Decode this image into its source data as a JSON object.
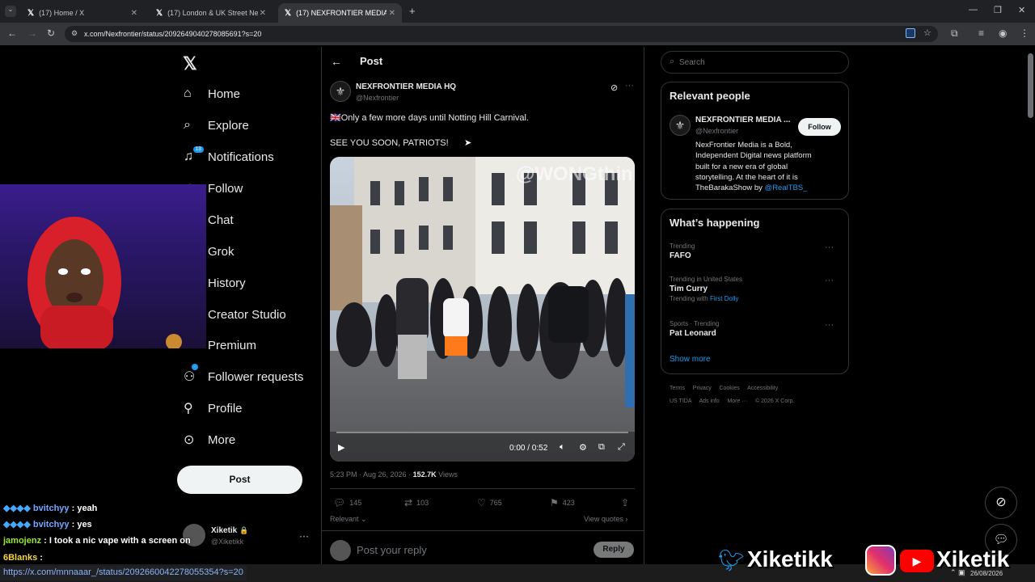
{
  "browser": {
    "tabs": [
      {
        "label": "(17) Home / X"
      },
      {
        "label": "(17) London & UK Street News"
      },
      {
        "label": "(17) NEXFRONTIER MEDIA HQ"
      }
    ],
    "url": "x.com/Nexfrontier/status/2092649040278085691?s=20"
  },
  "nav": {
    "items": [
      {
        "label": "Home"
      },
      {
        "label": "Explore"
      },
      {
        "label": "Notifications",
        "badge": "13"
      },
      {
        "label": "Follow"
      },
      {
        "label": "Chat"
      },
      {
        "label": "Grok"
      },
      {
        "label": "History"
      },
      {
        "label": "Creator Studio"
      },
      {
        "label": "Premium"
      },
      {
        "label": "Follower requests"
      },
      {
        "label": "Profile"
      },
      {
        "label": "More"
      }
    ],
    "post_button": "Post",
    "account": {
      "name": "Xiketik",
      "handle": "@Xiketikk"
    }
  },
  "post": {
    "header": "Post",
    "author": "NEXFRONTIER MEDIA HQ",
    "handle": "@Nexfrontier",
    "text1": "🇬🇧Only a few more days until Notting Hill Carnival.",
    "text2": "SEE YOU SOON, PATRIOTS!",
    "video_watermark": "@WONGthink",
    "video_time": "0:00 / 0:52",
    "video_progress": 0.0,
    "timestamp": "5:23 PM · Aug 26, 2026 · ",
    "views_count": "152.7K",
    "views_label": " Views",
    "replies": "145",
    "reposts": "103",
    "likes": "765",
    "bookmarks": "423",
    "sort_label": "Relevant",
    "view_quotes": "View quotes",
    "reply_placeholder": "Post your reply",
    "reply_button": "Reply"
  },
  "sidebar": {
    "search_placeholder": "Search",
    "relevant_title": "Relevant people",
    "person": {
      "name": "NEXFRONTIER MEDIA ...",
      "handle": "@Nexfrontier",
      "follow": "Follow",
      "bio_line1": "NexFrontier Media is a Bold,",
      "bio_line2": "Independent Digital news platform",
      "bio_line3": "built for a new era of global",
      "bio_line4": "storytelling. At the heart of it is",
      "bio_line5": "TheBarakaShow by ",
      "bio_link": "@RealTBS_"
    },
    "happening_title": "What’s happening",
    "trends": [
      {
        "context": "Trending",
        "name": "FAFO"
      },
      {
        "context": "Trending in United States",
        "name": "Tim Curry",
        "extra": "Trending with ",
        "extra_link": "First Dolly"
      },
      {
        "context": "Sports · Trending",
        "name": "Pat Leonard"
      }
    ],
    "show_more": "Show more",
    "footer_line1": "Terms     Privacy     Cookies     Accessibility",
    "footer_line2": "US TIDA     Ads info     More ···     © 2026 X Corp."
  },
  "stream": {
    "chat": [
      {
        "user": "bvitchyy",
        "msg": " : yeah"
      },
      {
        "user": "bvitchyy",
        "msg": " : yes"
      },
      {
        "user": "jamojenz",
        "msg": " : I took a nic vape with a screen on"
      },
      {
        "user": "6Blanks",
        "msg": " :"
      }
    ],
    "brand_left": "Xiketikk",
    "brand_right": "Xiketik",
    "status_url": "https://x.com/mnnaaar_/status/2092660042278055354?s=20",
    "clock_date": "26/08/2026"
  },
  "colors": {
    "accent": "#1d9bf0",
    "bg": "#000000"
  }
}
